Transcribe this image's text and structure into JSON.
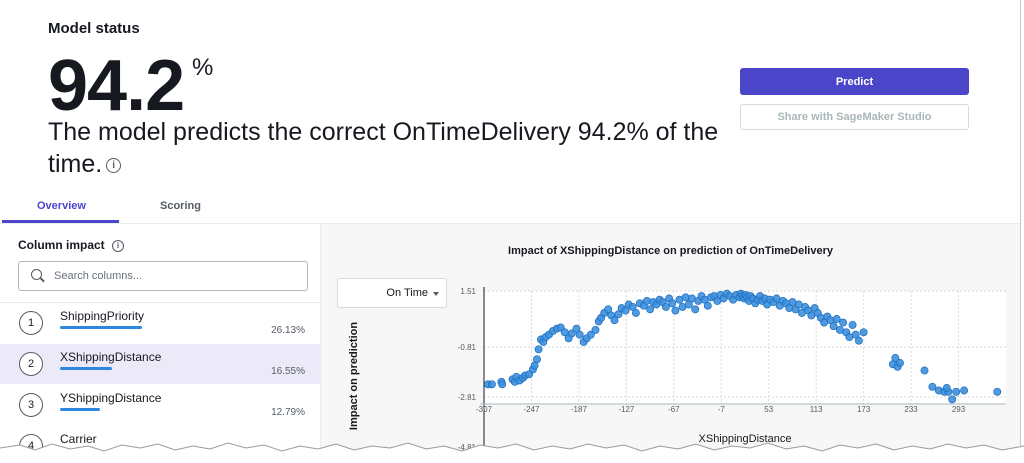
{
  "header": {
    "title": "Model status",
    "score": "94.2",
    "score_unit": "%",
    "description": "The model predicts the correct OnTimeDelivery 94.2% of the time."
  },
  "actions": {
    "predict_label": "Predict",
    "share_label": "Share with SageMaker Studio"
  },
  "tabs": [
    {
      "label": "Overview",
      "active": true
    },
    {
      "label": "Scoring",
      "active": false
    }
  ],
  "column_impact": {
    "title": "Column impact",
    "search_placeholder": "Search columns...",
    "items": [
      {
        "rank": "1",
        "name": "ShippingPriority",
        "value": "26.13%",
        "fraction": 0.2613,
        "selected": false
      },
      {
        "rank": "2",
        "name": "XShippingDistance",
        "value": "16.55%",
        "fraction": 0.1655,
        "selected": true
      },
      {
        "rank": "3",
        "name": "YShippingDistance",
        "value": "12.79%",
        "fraction": 0.1279,
        "selected": false
      },
      {
        "rank": "4",
        "name": "Carrier",
        "value": "",
        "fraction": null,
        "selected": false
      }
    ]
  },
  "target_dropdown": {
    "value": "On Time"
  },
  "colors": {
    "accent": "#4b46c9",
    "bar": "#2e86de",
    "point": "#3d8fdc",
    "point_stroke": "#1a6cbf"
  },
  "chart_data": {
    "type": "scatter",
    "title": "Impact of XShippingDistance on prediction of OnTimeDelivery",
    "xlabel": "XShippingDistance",
    "ylabel": "Impact on prediction",
    "x_ticks": [
      "-307",
      "-247",
      "-187",
      "-127",
      "-67",
      "-7",
      "53",
      "113",
      "173",
      "233",
      "293"
    ],
    "y_ticks": [
      "1.51",
      "-0.81",
      "-2.81",
      "-4.81"
    ],
    "xlim": [
      -307,
      353
    ],
    "ylim": [
      -4.81,
      1.51
    ],
    "grid": true,
    "points": [
      [
        -302,
        -2.3
      ],
      [
        -297,
        -2.3
      ],
      [
        -285,
        -2.2
      ],
      [
        -284,
        -2.3
      ],
      [
        -271,
        -2.1
      ],
      [
        -268,
        -2.2
      ],
      [
        -266,
        -2.0
      ],
      [
        -262,
        -2.15
      ],
      [
        -258,
        -2.05
      ],
      [
        -255,
        -1.95
      ],
      [
        -250,
        -1.9
      ],
      [
        -245,
        -1.7
      ],
      [
        -243,
        -1.55
      ],
      [
        -240,
        -1.3
      ],
      [
        -238,
        -0.9
      ],
      [
        -235,
        -0.5
      ],
      [
        -232,
        -0.6
      ],
      [
        -229,
        -0.4
      ],
      [
        -225,
        -0.3
      ],
      [
        -220,
        -0.15
      ],
      [
        -215,
        -0.05
      ],
      [
        -210,
        0.0
      ],
      [
        -205,
        -0.2
      ],
      [
        -200,
        -0.45
      ],
      [
        -196,
        -0.25
      ],
      [
        -190,
        -0.05
      ],
      [
        -186,
        -0.3
      ],
      [
        -181,
        -0.6
      ],
      [
        -177,
        -0.45
      ],
      [
        -172,
        -0.3
      ],
      [
        -166,
        -0.1
      ],
      [
        -162,
        0.25
      ],
      [
        -159,
        0.4
      ],
      [
        -155,
        0.6
      ],
      [
        -150,
        0.75
      ],
      [
        -146,
        0.5
      ],
      [
        -142,
        0.3
      ],
      [
        -137,
        0.55
      ],
      [
        -133,
        0.8
      ],
      [
        -128,
        0.7
      ],
      [
        -124,
        0.95
      ],
      [
        -119,
        0.85
      ],
      [
        -115,
        0.6
      ],
      [
        -110,
        1.0
      ],
      [
        -105,
        0.9
      ],
      [
        -101,
        1.1
      ],
      [
        -97,
        0.75
      ],
      [
        -93,
        1.05
      ],
      [
        -89,
        0.95
      ],
      [
        -85,
        1.15
      ],
      [
        -81,
        1.05
      ],
      [
        -77,
        0.85
      ],
      [
        -73,
        1.2
      ],
      [
        -69,
        1.0
      ],
      [
        -65,
        0.7
      ],
      [
        -60,
        1.15
      ],
      [
        -56,
        0.85
      ],
      [
        -52,
        1.25
      ],
      [
        -48,
        0.95
      ],
      [
        -44,
        1.2
      ],
      [
        -40,
        0.75
      ],
      [
        -36,
        1.1
      ],
      [
        -32,
        1.3
      ],
      [
        -28,
        1.15
      ],
      [
        -24,
        0.9
      ],
      [
        -20,
        1.25
      ],
      [
        -16,
        1.3
      ],
      [
        -12,
        1.1
      ],
      [
        -8,
        1.35
      ],
      [
        -4,
        1.2
      ],
      [
        0,
        1.4
      ],
      [
        4,
        1.3
      ],
      [
        8,
        1.15
      ],
      [
        12,
        1.35
      ],
      [
        16,
        1.25
      ],
      [
        18,
        1.4
      ],
      [
        20,
        1.3
      ],
      [
        22,
        1.2
      ],
      [
        24,
        1.35
      ],
      [
        26,
        1.25
      ],
      [
        28,
        1.1
      ],
      [
        30,
        1.3
      ],
      [
        33,
        1.2
      ],
      [
        36,
        1.0
      ],
      [
        39,
        1.15
      ],
      [
        42,
        1.3
      ],
      [
        45,
        1.1
      ],
      [
        48,
        1.2
      ],
      [
        51,
        0.95
      ],
      [
        55,
        1.15
      ],
      [
        59,
        1.05
      ],
      [
        63,
        1.2
      ],
      [
        67,
        0.9
      ],
      [
        71,
        1.1
      ],
      [
        75,
        1.0
      ],
      [
        79,
        0.8
      ],
      [
        83,
        1.05
      ],
      [
        87,
        0.75
      ],
      [
        91,
        0.95
      ],
      [
        95,
        0.6
      ],
      [
        99,
        0.85
      ],
      [
        103,
        0.7
      ],
      [
        107,
        0.5
      ],
      [
        111,
        0.8
      ],
      [
        115,
        0.6
      ],
      [
        119,
        0.4
      ],
      [
        123,
        0.2
      ],
      [
        127,
        0.45
      ],
      [
        131,
        0.3
      ],
      [
        135,
        0.05
      ],
      [
        139,
        0.35
      ],
      [
        143,
        -0.1
      ],
      [
        147,
        0.2
      ],
      [
        151,
        -0.2
      ],
      [
        155,
        -0.4
      ],
      [
        159,
        0.1
      ],
      [
        163,
        -0.3
      ],
      [
        167,
        -0.55
      ],
      [
        173,
        -0.2
      ],
      [
        210,
        -1.5
      ],
      [
        213,
        -1.25
      ],
      [
        216,
        -1.6
      ],
      [
        219,
        -1.45
      ],
      [
        250,
        -1.75
      ],
      [
        260,
        -2.4
      ],
      [
        268,
        -2.55
      ],
      [
        275,
        -2.6
      ],
      [
        280,
        -2.6
      ],
      [
        278,
        -2.45
      ],
      [
        285,
        -2.9
      ],
      [
        290,
        -2.6
      ],
      [
        300,
        -2.55
      ],
      [
        342,
        -2.6
      ]
    ]
  }
}
